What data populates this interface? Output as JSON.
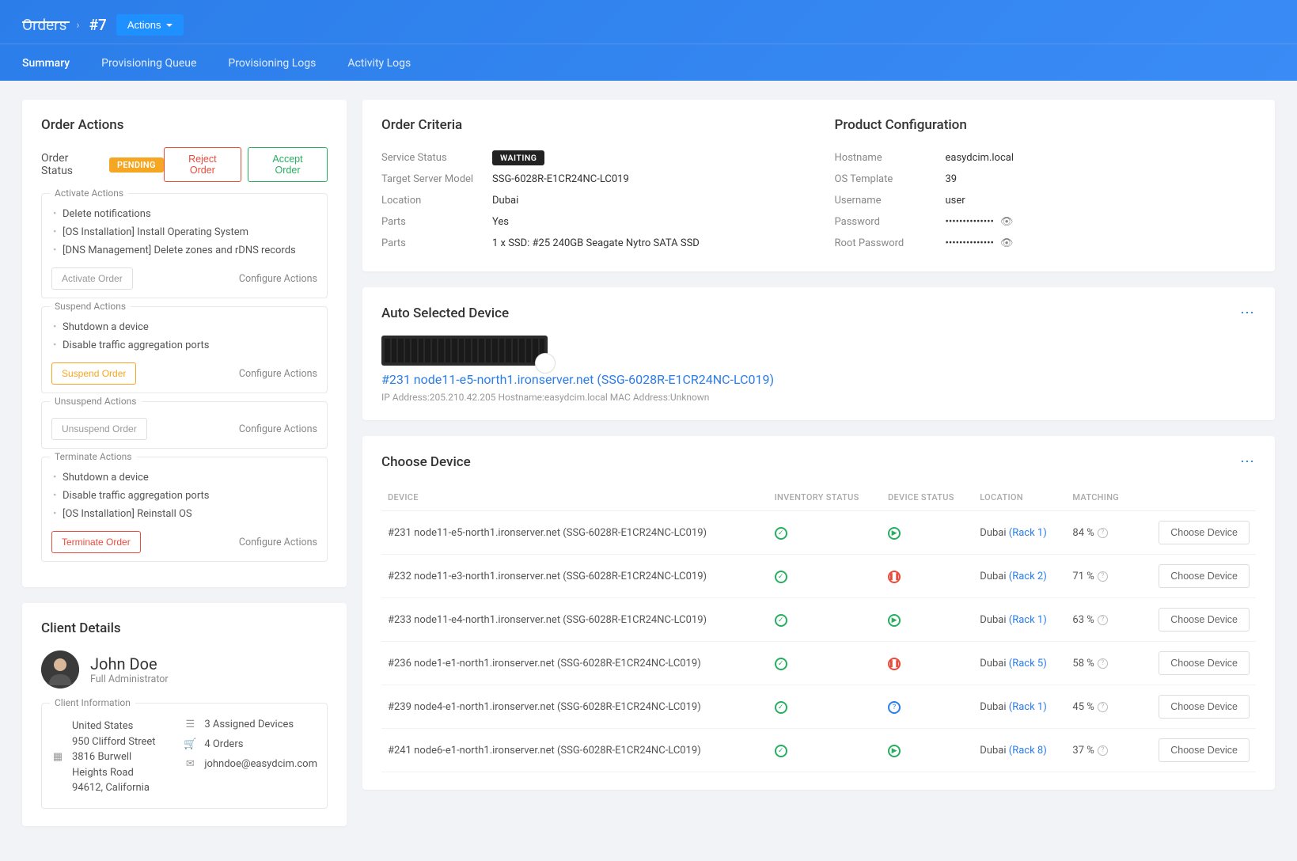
{
  "header": {
    "breadcrumb_root": "Orders",
    "breadcrumb_current": "#7",
    "actions_btn": "Actions"
  },
  "tabs": {
    "summary": "Summary",
    "prov_queue": "Provisioning Queue",
    "prov_logs": "Provisioning Logs",
    "activity_logs": "Activity Logs"
  },
  "order_actions": {
    "title": "Order Actions",
    "status_label": "Order Status",
    "status_badge": "PENDING",
    "reject": "Reject Order",
    "accept": "Accept Order",
    "activate": {
      "title": "Activate Actions",
      "items": [
        "Delete notifications",
        "[OS Installation] Install Operating System",
        "[DNS Management] Delete zones and rDNS records"
      ],
      "btn": "Activate Order",
      "config": "Configure Actions"
    },
    "suspend": {
      "title": "Suspend Actions",
      "items": [
        "Shutdown a device",
        "Disable traffic aggregation ports"
      ],
      "btn": "Suspend Order",
      "config": "Configure Actions"
    },
    "unsuspend": {
      "title": "Unsuspend Actions",
      "btn": "Unsuspend Order",
      "config": "Configure Actions"
    },
    "terminate": {
      "title": "Terminate Actions",
      "items": [
        "Shutdown a device",
        "Disable traffic aggregation ports",
        "[OS Installation] Reinstall OS"
      ],
      "btn": "Terminate Order",
      "config": "Configure Actions"
    }
  },
  "client": {
    "title": "Client Details",
    "name": "John Doe",
    "role": "Full Administrator",
    "info_title": "Client Information",
    "country": "United States",
    "addr1": "950 Clifford Street",
    "addr2": "3816 Burwell Heights Road",
    "addr3": "94612, California",
    "devices": "3 Assigned Devices",
    "orders": "4 Orders",
    "email": "johndoe@easydcim.com"
  },
  "criteria": {
    "title": "Order Criteria",
    "service_status_l": "Service Status",
    "service_status_v": "WAITING",
    "model_l": "Target Server Model",
    "model_v": "SSG-6028R-E1CR24NC-LC019",
    "location_l": "Location",
    "location_v": "Dubai",
    "parts_l": "Parts",
    "parts_v": "Yes",
    "parts2_l": "Parts",
    "parts2_v": "1 x SSD: #25 240GB Seagate Nytro SATA SSD"
  },
  "product": {
    "title": "Product Configuration",
    "hostname_l": "Hostname",
    "hostname_v": "easydcim.local",
    "ostpl_l": "OS Template",
    "ostpl_v": "39",
    "user_l": "Username",
    "user_v": "user",
    "pass_l": "Password",
    "pass_v": "••••••••••••••",
    "rootpass_l": "Root Password",
    "rootpass_v": "••••••••••••••"
  },
  "auto_device": {
    "title": "Auto Selected Device",
    "link": "#231 node11-e5-north1.ironserver.net (SSG-6028R-E1CR24NC-LC019)",
    "meta": "IP Address:205.210.42.205  Hostname:easydcim.local  MAC Address:Unknown"
  },
  "choose": {
    "title": "Choose Device",
    "th_device": "DEVICE",
    "th_inv": "INVENTORY STATUS",
    "th_dev": "DEVICE STATUS",
    "th_loc": "LOCATION",
    "th_match": "MATCHING",
    "btn": "Choose Device",
    "rows": [
      {
        "name": "#231 node11-e5-north1.ironserver.net (SSG-6028R-E1CR24NC-LC019)",
        "loc": "Dubai",
        "rack": "(Rack 1)",
        "match": "84 %",
        "dev": "play"
      },
      {
        "name": "#232 node11-e3-north1.ironserver.net (SSG-6028R-E1CR24NC-LC019)",
        "loc": "Dubai",
        "rack": "(Rack 2)",
        "match": "71 %",
        "dev": "pause"
      },
      {
        "name": "#233 node11-e4-north1.ironserver.net (SSG-6028R-E1CR24NC-LC019)",
        "loc": "Dubai",
        "rack": "(Rack 1)",
        "match": "63 %",
        "dev": "play"
      },
      {
        "name": "#236 node1-e1-north1.ironserver.net (SSG-6028R-E1CR24NC-LC019)",
        "loc": "Dubai",
        "rack": "(Rack 5)",
        "match": "58 %",
        "dev": "pause"
      },
      {
        "name": "#239 node4-e1-north1.ironserver.net (SSG-6028R-E1CR24NC-LC019)",
        "loc": "Dubai",
        "rack": "(Rack 1)",
        "match": "45 %",
        "dev": "info"
      },
      {
        "name": "#241 node6-e1-north1.ironserver.net (SSG-6028R-E1CR24NC-LC019)",
        "loc": "Dubai",
        "rack": "(Rack 8)",
        "match": "37 %",
        "dev": "play"
      }
    ]
  }
}
